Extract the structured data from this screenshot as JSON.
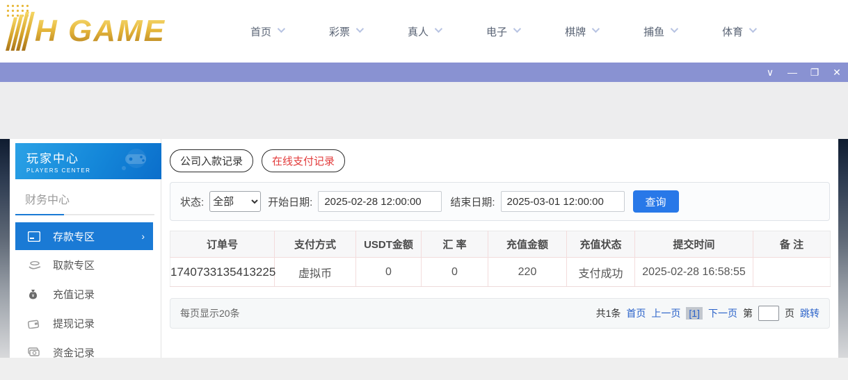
{
  "logo": {
    "text": "H GAME",
    "full_name": "HH GAME"
  },
  "nav": {
    "items": [
      {
        "label": "首页"
      },
      {
        "label": "彩票"
      },
      {
        "label": "真人"
      },
      {
        "label": "电子"
      },
      {
        "label": "棋牌"
      },
      {
        "label": "捕鱼"
      },
      {
        "label": "体育"
      }
    ]
  },
  "titlebar": {
    "controls": {
      "dropdown": "∨",
      "minimize": "—",
      "maximize": "❐",
      "close": "✕"
    }
  },
  "sidebar": {
    "header": {
      "title": "玩家中心",
      "subtitle": "PLAYERS CENTER"
    },
    "section": "财务中心",
    "items": [
      {
        "label": "存款专区",
        "active": true,
        "arrow": "›"
      },
      {
        "label": "取款专区",
        "active": false
      },
      {
        "label": "充值记录",
        "active": false
      },
      {
        "label": "提现记录",
        "active": false
      },
      {
        "label": "资金记录",
        "active": false
      }
    ]
  },
  "tabs": [
    {
      "label": "公司入款记录",
      "active": false
    },
    {
      "label": "在线支付记录",
      "active": true
    }
  ],
  "filters": {
    "status_label": "状态:",
    "status_value": "全部",
    "start_label": "开始日期:",
    "start_value": "2025-02-28 12:00:00",
    "end_label": "结束日期:",
    "end_value": "2025-03-01 12:00:00",
    "search_button": "查询"
  },
  "table": {
    "headers": [
      "订单号",
      "支付方式",
      "USDT金额",
      "汇 率",
      "充值金额",
      "充值状态",
      "提交时间",
      "备 注"
    ],
    "rows": [
      [
        "1740733135413225",
        "虚拟币",
        "0",
        "0",
        "220",
        "支付成功",
        "2025-02-28 16:58:55",
        ""
      ]
    ]
  },
  "pagination": {
    "per_page": "每页显示20条",
    "total": "共1条",
    "first": "首页",
    "prev": "上一页",
    "current": "[1]",
    "next": "下一页",
    "jump_prefix": "第",
    "jump_suffix": "页",
    "jump_action": "跳转",
    "jump_value": ""
  },
  "colors": {
    "titlebar": "#8992d2",
    "accent_blue": "#1a7ad5",
    "button_blue": "#2878e8",
    "link_blue": "#2a62c9",
    "tab_red": "#e23b3b",
    "logo_gold": "#d7a52c"
  }
}
